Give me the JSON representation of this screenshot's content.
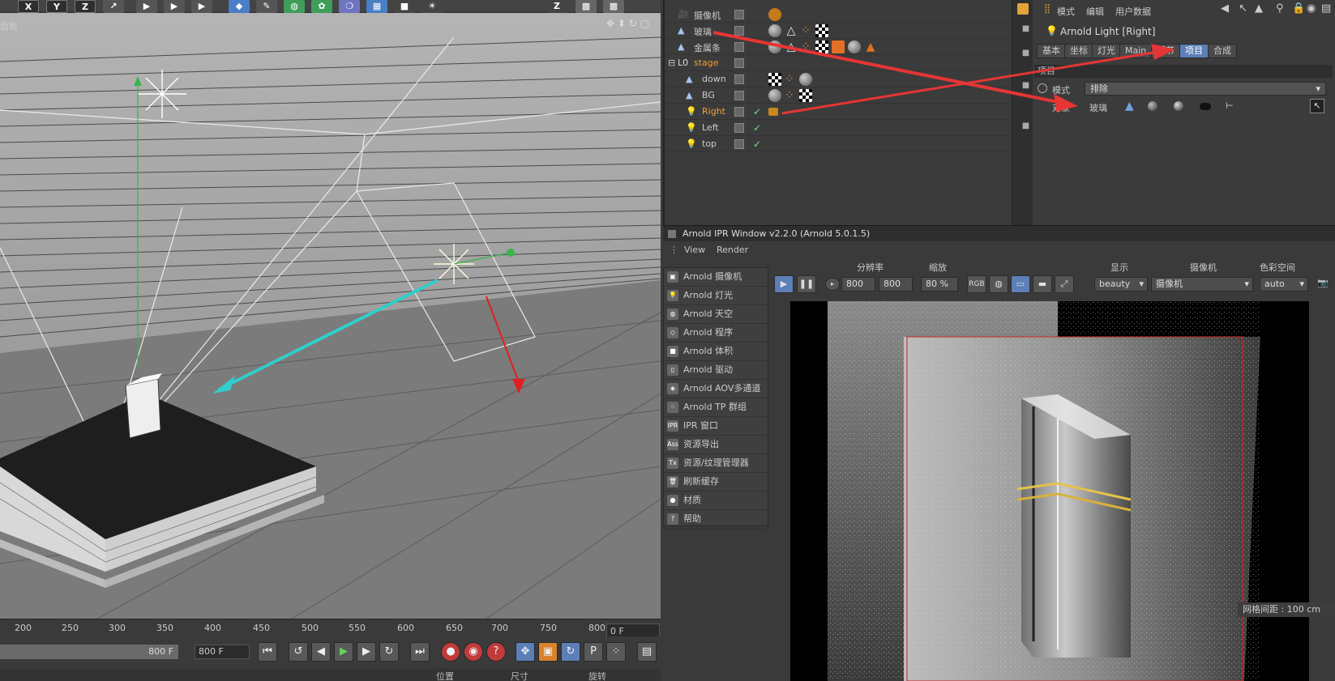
{
  "toolbar": {
    "buttons": [
      "X",
      "Y",
      "Z"
    ],
    "z_label": "Z"
  },
  "viewport": {
    "label": "面板",
    "grid_spacing": "网格间距 : 100 cm"
  },
  "timeline": {
    "ticks": [
      "200",
      "250",
      "300",
      "350",
      "400",
      "450",
      "500",
      "550",
      "600",
      "650",
      "700",
      "750",
      "800"
    ],
    "current_frame": "0 F",
    "range_end": "800 F",
    "end_field": "800 F"
  },
  "bottom_labels": {
    "position": "位置",
    "size": "尺寸",
    "rotation": "旋转"
  },
  "object_manager": {
    "objects": [
      {
        "name": "摄像机",
        "indent": 0,
        "type": "camera"
      },
      {
        "name": "玻璃",
        "indent": 0,
        "type": "poly"
      },
      {
        "name": "金属条",
        "indent": 0,
        "type": "poly"
      },
      {
        "name": "stage",
        "indent": 0,
        "type": "null"
      },
      {
        "name": "down",
        "indent": 1,
        "type": "poly"
      },
      {
        "name": "BG",
        "indent": 1,
        "type": "poly"
      },
      {
        "name": "Right",
        "indent": 1,
        "type": "light"
      },
      {
        "name": "Left",
        "indent": 1,
        "type": "light"
      },
      {
        "name": "top",
        "indent": 1,
        "type": "light"
      }
    ]
  },
  "attribute_manager": {
    "menu": [
      "模式",
      "编辑",
      "用户数据"
    ],
    "title": "Arnold Light [Right]",
    "tabs": [
      "基本",
      "坐标",
      "灯光",
      "Main",
      "细节",
      "项目",
      "合成"
    ],
    "active_tab": "项目",
    "section": "项目",
    "mode_label": "模式",
    "mode_value": "排除",
    "objects_label": "对象",
    "object_entry": "玻璃"
  },
  "ipr": {
    "title": "Arnold IPR Window v2.2.0 (Arnold 5.0.1.5)",
    "menu": [
      "View",
      "Render"
    ],
    "side_menu": [
      {
        "label": "Arnold 摄像机",
        "icon": "camera-icon"
      },
      {
        "label": "Arnold 灯光",
        "icon": "light-icon"
      },
      {
        "label": "Arnold 天空",
        "icon": "sky-icon"
      },
      {
        "label": "Arnold 程序",
        "icon": "procedural-icon"
      },
      {
        "label": "Arnold 体积",
        "icon": "volume-icon"
      },
      {
        "label": "Arnold 驱动",
        "icon": "driver-icon"
      },
      {
        "label": "Arnold AOV多通道",
        "icon": "aov-icon"
      },
      {
        "label": "Arnold TP 群组",
        "icon": "tp-icon"
      },
      {
        "label": "IPR 窗口",
        "icon": "ipr-icon"
      },
      {
        "label": "资源导出",
        "icon": "ass-icon"
      },
      {
        "label": "资源/纹理管理器",
        "icon": "tx-icon"
      },
      {
        "label": "刷新缓存",
        "icon": "trash-icon"
      },
      {
        "label": "材质",
        "icon": "material-icon"
      },
      {
        "label": "帮助",
        "icon": "help-icon"
      }
    ],
    "resolution_label": "分辨率",
    "res_w": "800",
    "res_h": "800",
    "zoom_label": "缩放",
    "zoom": "80 %",
    "display_label": "显示",
    "display_value": "beauty",
    "camera_label": "摄像机",
    "camera_value": "摄像机",
    "colorspace_label": "色彩空间",
    "colorspace_value": "auto",
    "rgb_label": "RGB"
  }
}
